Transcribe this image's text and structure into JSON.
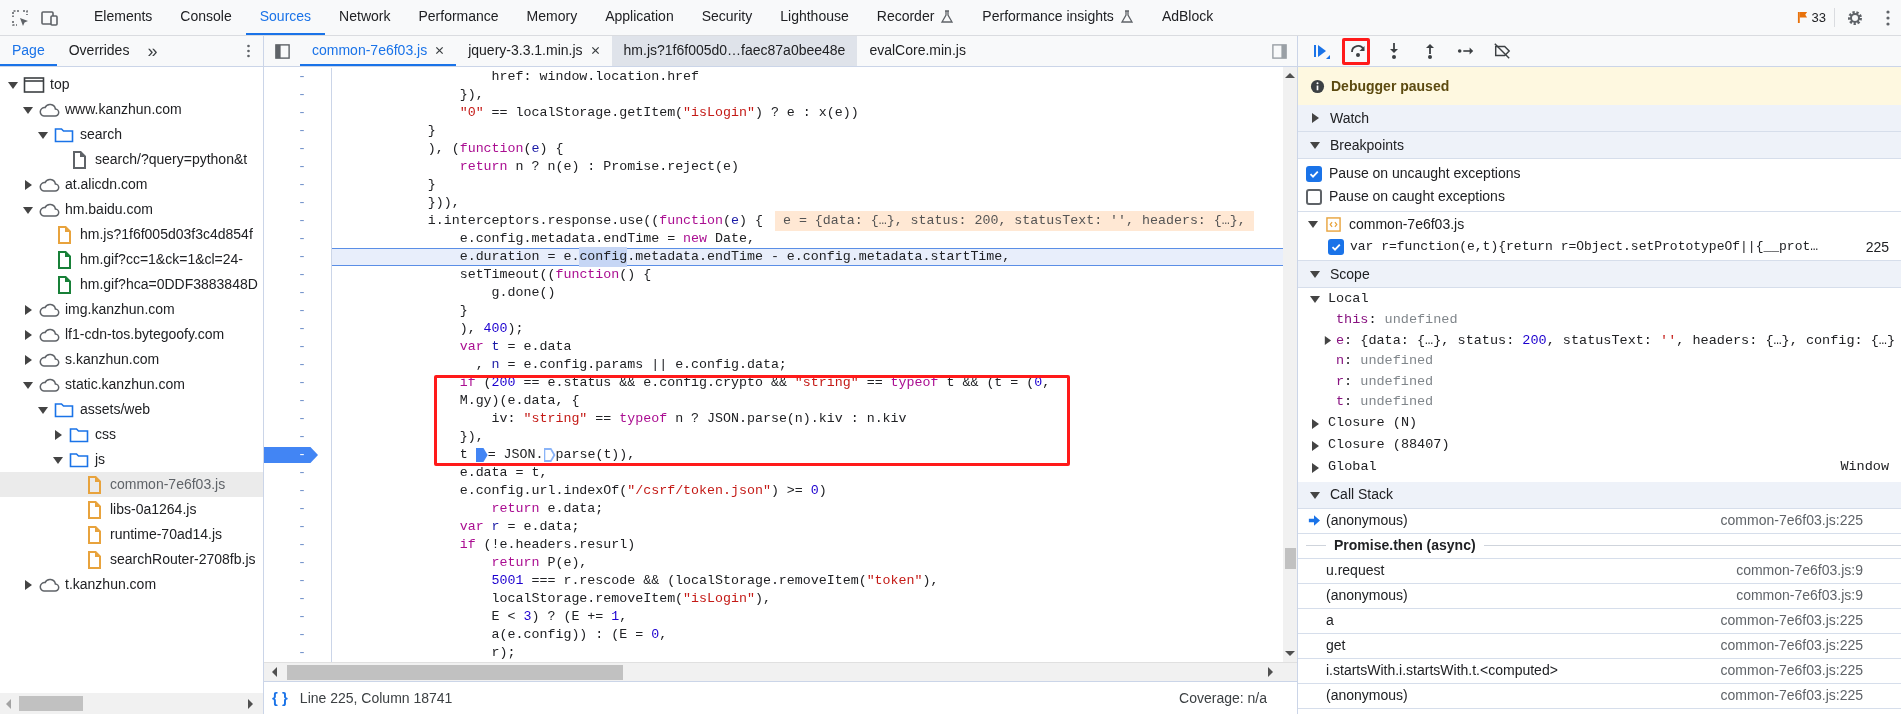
{
  "devtools_tabs": [
    {
      "label": "Elements",
      "selected": false,
      "experimental": false
    },
    {
      "label": "Console",
      "selected": false,
      "experimental": false
    },
    {
      "label": "Sources",
      "selected": true,
      "experimental": false
    },
    {
      "label": "Network",
      "selected": false,
      "experimental": false
    },
    {
      "label": "Performance",
      "selected": false,
      "experimental": false
    },
    {
      "label": "Memory",
      "selected": false,
      "experimental": false
    },
    {
      "label": "Application",
      "selected": false,
      "experimental": false
    },
    {
      "label": "Security",
      "selected": false,
      "experimental": false
    },
    {
      "label": "Lighthouse",
      "selected": false,
      "experimental": false
    },
    {
      "label": "Recorder",
      "selected": false,
      "experimental": true
    },
    {
      "label": "Performance insights",
      "selected": false,
      "experimental": true
    },
    {
      "label": "AdBlock",
      "selected": false,
      "experimental": false
    }
  ],
  "issues": {
    "count": "33"
  },
  "navigator": {
    "tabs": [
      {
        "label": "Page",
        "selected": true
      },
      {
        "label": "Overrides",
        "selected": false
      }
    ],
    "more": "»"
  },
  "file_tree": [
    {
      "label": "top",
      "kind": "frame",
      "expanded": true,
      "selected": false,
      "children": [
        {
          "label": "www.kanzhun.com",
          "kind": "domain",
          "expanded": true,
          "selected": false,
          "children": [
            {
              "label": "search",
              "kind": "folder",
              "expanded": true,
              "selected": false,
              "children": [
                {
                  "label": "search/?query=python&t",
                  "kind": "file",
                  "selected": false,
                  "color": "#5f6368"
                }
              ]
            }
          ]
        },
        {
          "label": "at.alicdn.com",
          "kind": "domain",
          "expanded": false,
          "selected": false
        },
        {
          "label": "hm.baidu.com",
          "kind": "domain",
          "expanded": true,
          "selected": false,
          "children": [
            {
              "label": "hm.js?1f6f005d03f3c4d854f",
              "kind": "file",
              "selected": false,
              "color": "#e8a33d"
            },
            {
              "label": "hm.gif?cc=1&ck=1&cl=24-",
              "kind": "file",
              "selected": false,
              "color": "#188038"
            },
            {
              "label": "hm.gif?hca=0DDF3883848D",
              "kind": "file",
              "selected": false,
              "color": "#188038"
            }
          ]
        },
        {
          "label": "img.kanzhun.com",
          "kind": "domain",
          "expanded": false,
          "selected": false
        },
        {
          "label": "lf1-cdn-tos.bytegoofy.com",
          "kind": "domain",
          "expanded": false,
          "selected": false
        },
        {
          "label": "s.kanzhun.com",
          "kind": "domain",
          "expanded": false,
          "selected": false
        },
        {
          "label": "static.kanzhun.com",
          "kind": "domain",
          "expanded": true,
          "selected": false,
          "children": [
            {
              "label": "assets/web",
              "kind": "folder",
              "expanded": true,
              "selected": false,
              "children": [
                {
                  "label": "css",
                  "kind": "folder",
                  "expanded": false,
                  "selected": false
                },
                {
                  "label": "js",
                  "kind": "folder",
                  "expanded": true,
                  "selected": false,
                  "children": [
                    {
                      "label": "common-7e6f03.js",
                      "kind": "file",
                      "selected": true,
                      "color": "#e8a33d"
                    },
                    {
                      "label": "libs-0a1264.js",
                      "kind": "file",
                      "selected": false,
                      "color": "#e8a33d"
                    },
                    {
                      "label": "runtime-70ad14.js",
                      "kind": "file",
                      "selected": false,
                      "color": "#e8a33d"
                    },
                    {
                      "label": "searchRouter-2708fb.js",
                      "kind": "file",
                      "selected": false,
                      "color": "#e8a33d"
                    }
                  ]
                }
              ]
            }
          ]
        },
        {
          "label": "t.kanzhun.com",
          "kind": "domain",
          "expanded": false,
          "selected": false
        }
      ]
    }
  ],
  "editor": {
    "tabs": [
      {
        "label": "common-7e6f03.js",
        "selected": true,
        "hovered": false,
        "close_button": true
      },
      {
        "label": "jquery-3.3.1.min.js",
        "selected": false,
        "hovered": false,
        "close_button": true
      },
      {
        "label": "hm.js?1f6f005d0…faec87a0bee48e",
        "selected": false,
        "hovered": true,
        "close_button": false
      },
      {
        "label": "evalCore.min.js",
        "selected": false,
        "hovered": false,
        "close_button": false
      }
    ],
    "lines": [
      {
        "gutter": "-",
        "highlighted": false,
        "breakpoint": false,
        "tokens": [
          {
            "kind": "plain",
            "text": "                    href: window.location.href"
          }
        ]
      },
      {
        "gutter": "-",
        "highlighted": false,
        "breakpoint": false,
        "tokens": [
          {
            "kind": "plain",
            "text": "                }),"
          }
        ]
      },
      {
        "gutter": "-",
        "highlighted": false,
        "breakpoint": false,
        "tokens": [
          {
            "kind": "string",
            "text": "                \"0\""
          },
          {
            "kind": "plain",
            "text": " == localStorage.getItem("
          },
          {
            "kind": "string",
            "text": "\"isLogin\""
          },
          {
            "kind": "plain",
            "text": ") ? e : x(e))"
          }
        ]
      },
      {
        "gutter": "-",
        "highlighted": false,
        "breakpoint": false,
        "tokens": [
          {
            "kind": "plain",
            "text": "            }"
          }
        ]
      },
      {
        "gutter": "-",
        "highlighted": false,
        "breakpoint": false,
        "tokens": [
          {
            "kind": "plain",
            "text": "            ), ("
          },
          {
            "kind": "keyword",
            "text": "function"
          },
          {
            "kind": "plain",
            "text": "("
          },
          {
            "kind": "variable",
            "text": "e"
          },
          {
            "kind": "plain",
            "text": ") {"
          }
        ]
      },
      {
        "gutter": "-",
        "highlighted": false,
        "breakpoint": false,
        "tokens": [
          {
            "kind": "keyword",
            "text": "                return"
          },
          {
            "kind": "plain",
            "text": " n ? n(e) : Promise.reject(e)"
          }
        ]
      },
      {
        "gutter": "-",
        "highlighted": false,
        "breakpoint": false,
        "tokens": [
          {
            "kind": "plain",
            "text": "            }"
          }
        ]
      },
      {
        "gutter": "-",
        "highlighted": false,
        "breakpoint": false,
        "tokens": [
          {
            "kind": "plain",
            "text": "            })),"
          }
        ]
      },
      {
        "gutter": "-",
        "highlighted": false,
        "breakpoint": false,
        "tokens": [
          {
            "kind": "plain",
            "text": "            i.interceptors.response.use(("
          },
          {
            "kind": "keyword",
            "text": "function"
          },
          {
            "kind": "plain",
            "text": "("
          },
          {
            "kind": "variable",
            "text": "e"
          },
          {
            "kind": "plain",
            "text": ") {"
          }
        ],
        "inline_value": "e = {data: {…}, status: 200, statusText: '', headers: {…},"
      },
      {
        "gutter": "-",
        "highlighted": false,
        "breakpoint": false,
        "tokens": [
          {
            "kind": "plain",
            "text": "                e.config.metadata.endTime = "
          },
          {
            "kind": "keyword",
            "text": "new"
          },
          {
            "kind": "plain",
            "text": " Date,"
          }
        ]
      },
      {
        "gutter": "-",
        "highlighted": true,
        "breakpoint": false,
        "tokens": [
          {
            "kind": "plain",
            "text": "                e.duration = e."
          },
          {
            "kind": "selection",
            "text": "config"
          },
          {
            "kind": "plain",
            "text": ".metadata.endTime - e.config.metadata.startTime,"
          }
        ]
      },
      {
        "gutter": "-",
        "highlighted": false,
        "breakpoint": false,
        "tokens": [
          {
            "kind": "plain",
            "text": "                setTimeout(("
          },
          {
            "kind": "keyword",
            "text": "function"
          },
          {
            "kind": "plain",
            "text": "() {"
          }
        ]
      },
      {
        "gutter": "-",
        "highlighted": false,
        "breakpoint": false,
        "tokens": [
          {
            "kind": "plain",
            "text": "                    g.done()"
          }
        ]
      },
      {
        "gutter": "-",
        "highlighted": false,
        "breakpoint": false,
        "tokens": [
          {
            "kind": "plain",
            "text": "                }"
          }
        ]
      },
      {
        "gutter": "-",
        "highlighted": false,
        "breakpoint": false,
        "tokens": [
          {
            "kind": "plain",
            "text": "                ), "
          },
          {
            "kind": "number",
            "text": "400"
          },
          {
            "kind": "plain",
            "text": ");"
          }
        ]
      },
      {
        "gutter": "-",
        "highlighted": false,
        "breakpoint": false,
        "tokens": [
          {
            "kind": "keyword",
            "text": "                var "
          },
          {
            "kind": "variable",
            "text": "t"
          },
          {
            "kind": "plain",
            "text": " = e.data"
          }
        ]
      },
      {
        "gutter": "-",
        "highlighted": false,
        "breakpoint": false,
        "tokens": [
          {
            "kind": "plain",
            "text": "                  , "
          },
          {
            "kind": "variable",
            "text": "n"
          },
          {
            "kind": "plain",
            "text": " = e.config.params || e.config.data;"
          }
        ]
      },
      {
        "gutter": "-",
        "highlighted": false,
        "breakpoint": false,
        "tokens": [
          {
            "kind": "keyword",
            "text": "                if"
          },
          {
            "kind": "plain",
            "text": " ("
          },
          {
            "kind": "number",
            "text": "200"
          },
          {
            "kind": "plain",
            "text": " == e.status && e.config.crypto && "
          },
          {
            "kind": "string",
            "text": "\"string\""
          },
          {
            "kind": "plain",
            "text": " == "
          },
          {
            "kind": "keyword",
            "text": "typeof"
          },
          {
            "kind": "plain",
            "text": " t && (t = ("
          },
          {
            "kind": "number",
            "text": "0"
          },
          {
            "kind": "plain",
            "text": ","
          }
        ]
      },
      {
        "gutter": "-",
        "highlighted": false,
        "breakpoint": false,
        "tokens": [
          {
            "kind": "plain",
            "text": "                M.gy)(e.data, {"
          }
        ]
      },
      {
        "gutter": "-",
        "highlighted": false,
        "breakpoint": false,
        "tokens": [
          {
            "kind": "plain",
            "text": "                    iv: "
          },
          {
            "kind": "string",
            "text": "\"string\""
          },
          {
            "kind": "plain",
            "text": " == "
          },
          {
            "kind": "keyword",
            "text": "typeof"
          },
          {
            "kind": "plain",
            "text": " n ? JSON.parse(n).kiv : n.kiv"
          }
        ]
      },
      {
        "gutter": "-",
        "highlighted": false,
        "breakpoint": false,
        "tokens": [
          {
            "kind": "plain",
            "text": "                }),"
          }
        ]
      },
      {
        "gutter": "-",
        "highlighted": false,
        "breakpoint": true,
        "tokens": [
          {
            "kind": "plain",
            "text": "                t "
          },
          {
            "kind": "inline_breakpoint",
            "active": true
          },
          {
            "kind": "plain",
            "text": "= JSON."
          },
          {
            "kind": "inline_breakpoint",
            "active": false
          },
          {
            "kind": "plain",
            "text": "parse(t)),"
          }
        ]
      },
      {
        "gutter": "-",
        "highlighted": false,
        "breakpoint": false,
        "tokens": [
          {
            "kind": "plain",
            "text": "                e.data = t,"
          }
        ]
      },
      {
        "gutter": "-",
        "highlighted": false,
        "breakpoint": false,
        "tokens": [
          {
            "kind": "plain",
            "text": "                e.config.url.indexOf("
          },
          {
            "kind": "string",
            "text": "\"/csrf/token.json\""
          },
          {
            "kind": "plain",
            "text": ") >= "
          },
          {
            "kind": "number",
            "text": "0"
          },
          {
            "kind": "plain",
            "text": ")"
          }
        ]
      },
      {
        "gutter": "-",
        "highlighted": false,
        "breakpoint": false,
        "tokens": [
          {
            "kind": "keyword",
            "text": "                    return"
          },
          {
            "kind": "plain",
            "text": " e.data;"
          }
        ]
      },
      {
        "gutter": "-",
        "highlighted": false,
        "breakpoint": false,
        "tokens": [
          {
            "kind": "keyword",
            "text": "                var "
          },
          {
            "kind": "variable",
            "text": "r"
          },
          {
            "kind": "plain",
            "text": " = e.data;"
          }
        ]
      },
      {
        "gutter": "-",
        "highlighted": false,
        "breakpoint": false,
        "tokens": [
          {
            "kind": "keyword",
            "text": "                if"
          },
          {
            "kind": "plain",
            "text": " (!e.headers.resurl)"
          }
        ]
      },
      {
        "gutter": "-",
        "highlighted": false,
        "breakpoint": false,
        "tokens": [
          {
            "kind": "keyword",
            "text": "                    return"
          },
          {
            "kind": "plain",
            "text": " P(e),"
          }
        ]
      },
      {
        "gutter": "-",
        "highlighted": false,
        "breakpoint": false,
        "tokens": [
          {
            "kind": "number",
            "text": "                    5001"
          },
          {
            "kind": "plain",
            "text": " === r.rescode && (localStorage.removeItem("
          },
          {
            "kind": "string",
            "text": "\"token\""
          },
          {
            "kind": "plain",
            "text": "),"
          }
        ]
      },
      {
        "gutter": "-",
        "highlighted": false,
        "breakpoint": false,
        "tokens": [
          {
            "kind": "plain",
            "text": "                    localStorage.removeItem("
          },
          {
            "kind": "string",
            "text": "\"isLogin\""
          },
          {
            "kind": "plain",
            "text": "),"
          }
        ]
      },
      {
        "gutter": "-",
        "highlighted": false,
        "breakpoint": false,
        "tokens": [
          {
            "kind": "plain",
            "text": "                    E < "
          },
          {
            "kind": "number",
            "text": "3"
          },
          {
            "kind": "plain",
            "text": ") ? (E += "
          },
          {
            "kind": "number",
            "text": "1"
          },
          {
            "kind": "plain",
            "text": ","
          }
        ]
      },
      {
        "gutter": "-",
        "highlighted": false,
        "breakpoint": false,
        "tokens": [
          {
            "kind": "plain",
            "text": "                    a(e.config)) : (E = "
          },
          {
            "kind": "number",
            "text": "0"
          },
          {
            "kind": "plain",
            "text": ","
          }
        ]
      },
      {
        "gutter": "-",
        "highlighted": false,
        "breakpoint": false,
        "tokens": [
          {
            "kind": "plain",
            "text": "                    r);"
          }
        ]
      }
    ],
    "status": {
      "format_button": "{ }",
      "position": "Line 225, Column 18741",
      "coverage": "Coverage: n/a"
    }
  },
  "debugger": {
    "banner": "Debugger paused",
    "watch": {
      "title": "Watch",
      "expanded": false
    },
    "breakpoints": {
      "title": "Breakpoints",
      "expanded": true,
      "options": [
        {
          "label": "Pause on uncaught exceptions",
          "checked": true
        },
        {
          "label": "Pause on caught exceptions",
          "checked": false
        }
      ],
      "files": [
        {
          "name": "common-7e6f03.js",
          "expanded": true,
          "items": [
            {
              "code": "var r=function(e,t){return r=Object.setPrototypeOf||{__prot…",
              "line": "225",
              "checked": true
            }
          ]
        }
      ]
    },
    "scope": {
      "title": "Scope",
      "expanded": true,
      "groups": [
        {
          "name": "Local",
          "expanded": true,
          "vars": [
            {
              "name": "this",
              "kind": "primitive",
              "value": [
                {
                  "kind": "plain",
                  "text": ": "
                },
                {
                  "kind": "undefined",
                  "text": "undefined"
                }
              ]
            },
            {
              "name": "e",
              "kind": "object",
              "value": [
                {
                  "kind": "plain",
                  "text": ": {data: {…}, status: "
                },
                {
                  "kind": "number",
                  "text": "200"
                },
                {
                  "kind": "plain",
                  "text": ", statusText: "
                },
                {
                  "kind": "string",
                  "text": "''"
                },
                {
                  "kind": "plain",
                  "text": ", headers: {…}, config: {…}"
                }
              ]
            },
            {
              "name": "n",
              "kind": "primitive",
              "value": [
                {
                  "kind": "plain",
                  "text": ": "
                },
                {
                  "kind": "undefined",
                  "text": "undefined"
                }
              ]
            },
            {
              "name": "r",
              "kind": "primitive",
              "value": [
                {
                  "kind": "plain",
                  "text": ": "
                },
                {
                  "kind": "undefined",
                  "text": "undefined"
                }
              ]
            },
            {
              "name": "t",
              "kind": "primitive",
              "value": [
                {
                  "kind": "plain",
                  "text": ": "
                },
                {
                  "kind": "undefined",
                  "text": "undefined"
                }
              ]
            }
          ]
        },
        {
          "name": "Closure (N)",
          "expanded": false
        },
        {
          "name": "Closure (88407)",
          "expanded": false
        },
        {
          "name": "Global",
          "expanded": false,
          "value": "Window"
        }
      ]
    },
    "call_stack": {
      "title": "Call Stack",
      "expanded": true,
      "frames": [
        {
          "kind": "frame",
          "name": "(anonymous)",
          "location": "common-7e6f03.js:225",
          "current": true
        },
        {
          "kind": "async",
          "name": "Promise.then (async)"
        },
        {
          "kind": "frame",
          "name": "u.request",
          "location": "common-7e6f03.js:9",
          "current": false
        },
        {
          "kind": "frame",
          "name": "(anonymous)",
          "location": "common-7e6f03.js:9",
          "current": false
        },
        {
          "kind": "frame",
          "name": "a",
          "location": "common-7e6f03.js:225",
          "current": false
        },
        {
          "kind": "frame",
          "name": "get",
          "location": "common-7e6f03.js:225",
          "current": false
        },
        {
          "kind": "frame",
          "name": "i.startsWith.i.startsWith.t.<computed>",
          "location": "common-7e6f03.js:225",
          "current": false
        },
        {
          "kind": "frame",
          "name": "(anonymous)",
          "location": "common-7e6f03.js:225",
          "current": false
        }
      ]
    }
  }
}
